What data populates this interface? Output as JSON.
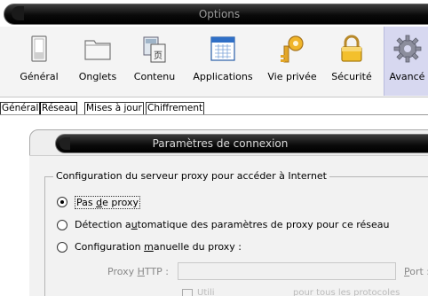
{
  "window": {
    "title": "Options"
  },
  "toolbar": {
    "items": [
      {
        "label": "Général"
      },
      {
        "label": "Onglets"
      },
      {
        "label": "Contenu"
      },
      {
        "label": "Applications"
      },
      {
        "label": "Vie privée"
      },
      {
        "label": "Sécurité"
      },
      {
        "label": "Avancé"
      }
    ],
    "active_index": 6,
    "active_color": "#d7d8f0"
  },
  "subtabs": [
    {
      "label": "Général"
    },
    {
      "label": "Réseau"
    },
    {
      "label": "Mises à jour"
    },
    {
      "label": "Chiffrement"
    }
  ],
  "dialog": {
    "title": "Paramètres de connexion",
    "group_label": "Configuration du serveur proxy pour accéder à Internet",
    "options": [
      {
        "pre": "Pas ",
        "key": "d",
        "post": "e proxy",
        "checked": true
      },
      {
        "pre": "Détection a",
        "key": "u",
        "post": "tomatique des paramètres de proxy pour ce réseau",
        "checked": false
      },
      {
        "pre": "Configuration ",
        "key": "m",
        "post": "anuelle du proxy :",
        "checked": false
      }
    ],
    "proxy_http": {
      "pre": "Proxy ",
      "key": "H",
      "post": "TTP :",
      "value": ""
    },
    "port": {
      "key": "P",
      "post": "ort :"
    },
    "checkbox": {
      "text_a": "Utili",
      "text_b": "pour tous les protocoles"
    }
  }
}
